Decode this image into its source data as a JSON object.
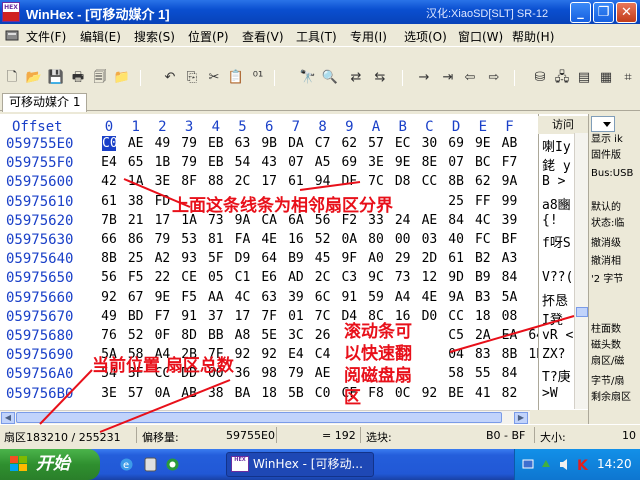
{
  "window": {
    "title": "WinHex - [可移动媒介 1]",
    "title_right": "汉化:XiaoSD[SLT] SR-12",
    "logo_top": "HEX",
    "minimize_glyph": "_",
    "maximize_glyph": "❐",
    "close_glyph": "✕"
  },
  "menu": [
    "文件(F)",
    "编辑(E)",
    "搜索(S)",
    "位置(P)",
    "查看(V)",
    "工具(T)",
    "专用(I)",
    "选项(O)",
    "窗口(W)",
    "帮助(H)"
  ],
  "tab": {
    "label": "可移动媒介 1"
  },
  "hex": {
    "offset_header": "Offset",
    "col_headers": [
      "0",
      "1",
      "2",
      "3",
      "4",
      "5",
      "6",
      "7",
      "8",
      "9",
      "A",
      "B",
      "C",
      "D",
      "E",
      "F"
    ],
    "rows": [
      {
        "offset": "059755E0",
        "bytes": [
          "C0",
          "AE",
          "49",
          "79",
          "EB",
          "63",
          "9B",
          "DA",
          "C7",
          "62",
          "57",
          "EC",
          "30",
          "69",
          "9E",
          "AB"
        ]
      },
      {
        "offset": "059755F0",
        "bytes": [
          "E4",
          "65",
          "1B",
          "79",
          "EB",
          "54",
          "43",
          "07",
          "A5",
          "69",
          "3E",
          "9E",
          "8E",
          "07",
          "BC",
          "F7"
        ]
      },
      {
        "offset": "05975600",
        "bytes": [
          "42",
          "1A",
          "3E",
          "8F",
          "88",
          "2C",
          "17",
          "61",
          "94",
          "DF",
          "7C",
          "D8",
          "CC",
          "8B",
          "62",
          "9A"
        ]
      },
      {
        "offset": "05975610",
        "bytes": [
          "61",
          "38",
          "FD",
          "",
          "",
          "",
          "",
          "",
          "",
          "",
          "",
          "",
          "",
          "25",
          "FF",
          "99"
        ]
      },
      {
        "offset": "05975620",
        "bytes": [
          "7B",
          "21",
          "17",
          "1A",
          "73",
          "9A",
          "CA",
          "6A",
          "56",
          "F2",
          "33",
          "24",
          "AE",
          "84",
          "4C",
          "39"
        ]
      },
      {
        "offset": "05975630",
        "bytes": [
          "66",
          "86",
          "79",
          "53",
          "81",
          "FA",
          "4E",
          "16",
          "52",
          "0A",
          "80",
          "00",
          "03",
          "40",
          "FC",
          "BF"
        ]
      },
      {
        "offset": "05975640",
        "bytes": [
          "8B",
          "25",
          "A2",
          "93",
          "5F",
          "D9",
          "64",
          "B9",
          "45",
          "9F",
          "A0",
          "29",
          "2D",
          "61",
          "B2",
          "A3"
        ]
      },
      {
        "offset": "05975650",
        "bytes": [
          "56",
          "F5",
          "22",
          "CE",
          "05",
          "C1",
          "E6",
          "AD",
          "2C",
          "C3",
          "9C",
          "73",
          "12",
          "9D",
          "B9",
          "84"
        ]
      },
      {
        "offset": "05975660",
        "bytes": [
          "92",
          "67",
          "9E",
          "F5",
          "AA",
          "4C",
          "63",
          "39",
          "6C",
          "91",
          "59",
          "A4",
          "4E",
          "9A",
          "B3",
          "5A"
        ]
      },
      {
        "offset": "05975670",
        "bytes": [
          "49",
          "BD",
          "F7",
          "91",
          "37",
          "17",
          "7F",
          "01",
          "7C",
          "D4",
          "8C",
          "16",
          "D0",
          "CC",
          "18",
          "08"
        ]
      },
      {
        "offset": "05975680",
        "bytes": [
          "76",
          "52",
          "0F",
          "8D",
          "BB",
          "A8",
          "5E",
          "3C",
          "26",
          "",
          "",
          "",
          "",
          "C5",
          "2A",
          "EA",
          "64"
        ]
      },
      {
        "offset": "05975690",
        "bytes": [
          "5A",
          "58",
          "A4",
          "2B",
          "7F",
          "92",
          "92",
          "E4",
          "C4",
          "",
          "",
          "",
          "",
          "04",
          "83",
          "8B",
          "1E"
        ]
      },
      {
        "offset": "059756A0",
        "bytes": [
          "54",
          "3F",
          "CC",
          "DD",
          "00",
          "36",
          "98",
          "79",
          "AE",
          "",
          "",
          "",
          "",
          "58",
          "55",
          "84"
        ]
      },
      {
        "offset": "059756B0",
        "bytes": [
          "3E",
          "57",
          "0A",
          "AB",
          "38",
          "BA",
          "18",
          "5B",
          "C0",
          "CF",
          "F8",
          "0C",
          "92",
          "BE",
          "41",
          "82"
        ]
      }
    ]
  },
  "text_pane": {
    "header": "访问",
    "lines": [
      "喇Iy",
      "銠 y",
      "B >",
      "a8豳",
      "{!",
      "f呀S",
      "",
      "V??(",
      "抔恳",
      "I凳",
      "vR <",
      "ZX?",
      "T?庚",
      ">W"
    ]
  },
  "side_panel": {
    "lines": [
      "显示 ik",
      "固件版",
      "Bus:USB",
      "默认的",
      "状态:临",
      "撤消级",
      "撤消相",
      "'2 字节",
      "柱面数",
      "磁头数",
      "扇区/磁",
      "字节/扇",
      "剩余扇区"
    ]
  },
  "status": {
    "sector": "扇区183210 / 255231",
    "offset_label": "偏移量:",
    "offset_value": "59755E0",
    "value": "= 192",
    "block_label": "选块:",
    "block_value": "B0 - BF",
    "size_label": "大小:",
    "size_value": "10"
  },
  "annotations": {
    "boundary": "上面这条线条为相邻扇区分界",
    "position": "当前位置 扇区总数",
    "scroll_l1": "滚动条可",
    "scroll_l2": "以快速翻",
    "scroll_l3": "阅磁盘扇",
    "scroll_l4": "区"
  },
  "taskbar": {
    "start_label": "开始",
    "task_label": "WinHex - [可移动...",
    "clock": "14:20",
    "task_icon_text": "HEX"
  },
  "colors": {
    "offset_blue": "#1a40c8",
    "annotation_red": "#e8101a",
    "title_blue": "#0a4fd0"
  }
}
